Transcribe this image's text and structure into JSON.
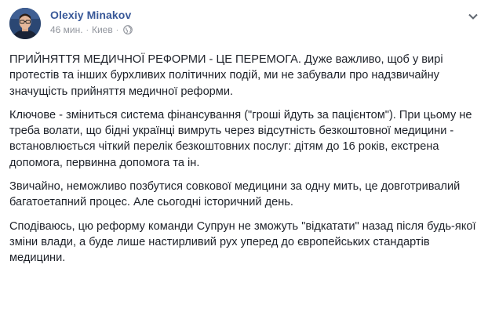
{
  "post": {
    "author": "Olexiy Minakov",
    "time": "46 мин.",
    "separator": "·",
    "location": "Киев",
    "paragraphs": [
      "ПРИЙНЯТТЯ МЕДИЧНОЇ РЕФОРМИ - ЦЕ ПЕРЕМОГА. Дуже важливо, щоб у вирі протестів та інших бурхливих політичних подій, ми не забували про надзвичайну значущість прийняття медичної реформи.",
      "Ключове - зміниться система фінансування (\"гроші йдуть за пацієнтом\"). При цьому не треба волати, що бідні українці вимруть через відсутність безкоштовної медицини - встановлюється чіткий перелік безкоштовних послуг: дітям до 16 років, екстрена допомога, первинна допомога та ін.",
      "Звичайно, неможливо позбутися совкової медицини за одну мить, це довготривалий багатоетапний процес. Але сьогодні історичний день.",
      "Сподіваюсь, цю реформу команди Супрун не зможуть \"відкатати\" назад після будь-якої зміни влади, а буде лише настирливий рух уперед до європейських стандартів медицини."
    ]
  },
  "icons": {
    "privacy": "globe-icon",
    "options": "chevron-down-icon"
  },
  "colors": {
    "author": "#385898",
    "meta": "#90949c",
    "text": "#1d2129"
  }
}
